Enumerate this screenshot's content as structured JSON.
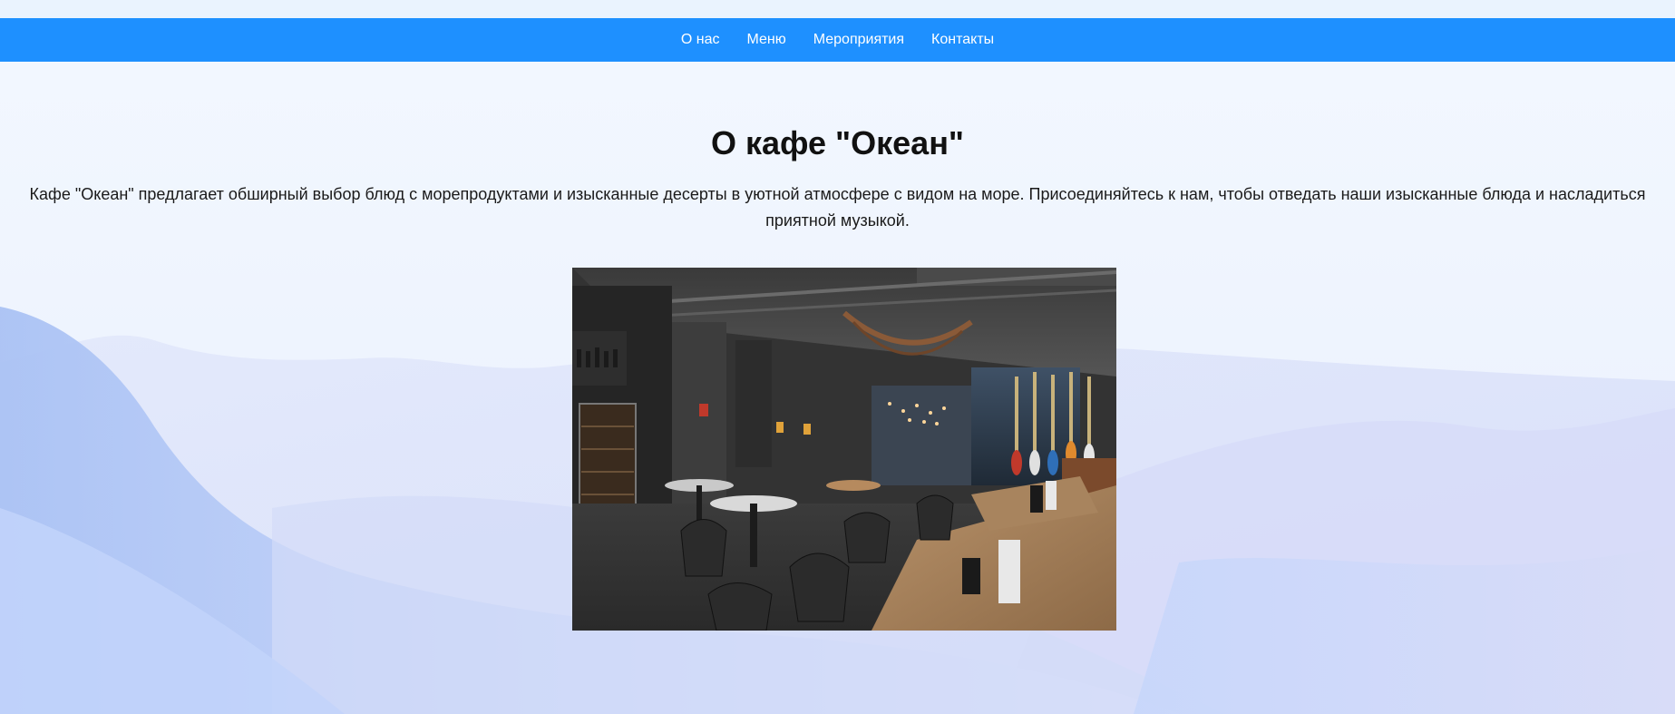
{
  "nav": {
    "items": [
      {
        "label": "О нас"
      },
      {
        "label": "Меню"
      },
      {
        "label": "Мероприятия"
      },
      {
        "label": "Контакты"
      }
    ]
  },
  "main": {
    "title": "О кафе \"Океан\"",
    "intro": "Кафе \"Океан\" предлагает обширный выбор блюд с морепродуктами и изысканные десерты в уютной атмосфере с видом на море. Присоединяйтесь к нам, чтобы отведать наши изысканные блюда и насладиться приятной музыкой."
  },
  "colors": {
    "nav_bg": "#1e90ff",
    "nav_text": "#ffffff",
    "page_bg": "#eef5ff",
    "wave_light": "#dde6fb",
    "wave_mid": "#c2d3f9",
    "wave_dark": "#a9c1f4"
  }
}
